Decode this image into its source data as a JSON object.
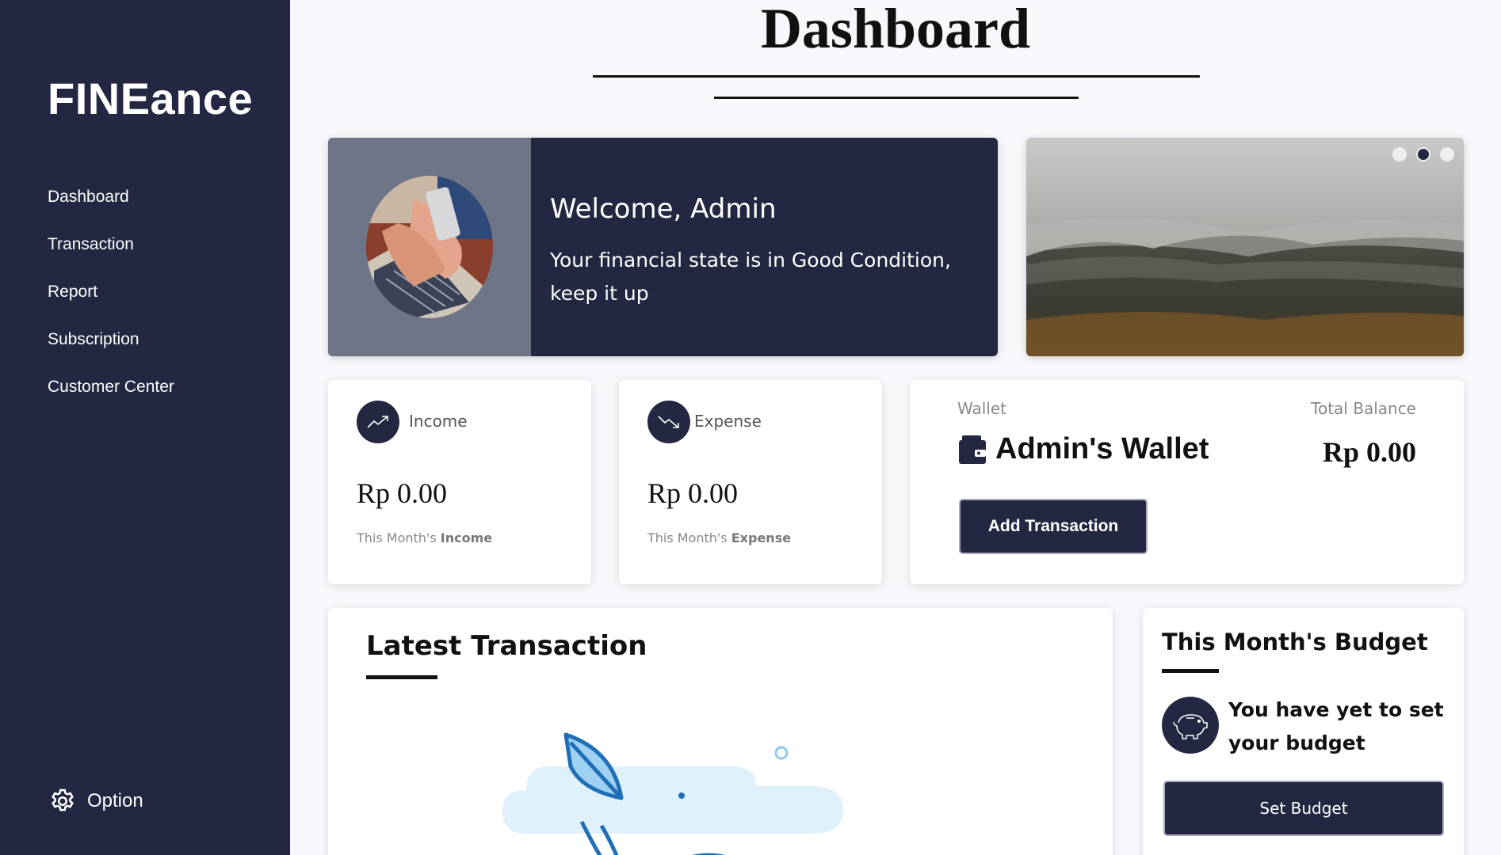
{
  "sidebar": {
    "brand": "FINEance",
    "items": [
      {
        "label": "Dashboard"
      },
      {
        "label": "Transaction"
      },
      {
        "label": "Report"
      },
      {
        "label": "Subscription"
      },
      {
        "label": "Customer Center"
      }
    ],
    "option_label": "Option"
  },
  "header": {
    "title": "Dashboard"
  },
  "welcome": {
    "title": "Welcome, Admin",
    "message": "Your financial state is in Good Condition, keep it up"
  },
  "carousel": {
    "slide_count": 3,
    "active_index": 1
  },
  "income": {
    "label": "Income",
    "value": "Rp 0.00",
    "caption_prefix": "This Month's ",
    "caption_strong": "Income",
    "icon": "trend-up-icon"
  },
  "expense": {
    "label": "Expense",
    "value": "Rp 0.00",
    "caption_prefix": "This Month's ",
    "caption_strong": "Expense",
    "icon": "trend-down-icon"
  },
  "wallet": {
    "label": "Wallet",
    "name": "Admin's Wallet",
    "balance_label": "Total Balance",
    "balance": "Rp 0.00",
    "add_button": "Add Transaction",
    "icon": "wallet-icon"
  },
  "latest": {
    "title": "Latest Transaction"
  },
  "budget": {
    "title": "This Month's Budget",
    "message": "You have yet to set your budget",
    "button": "Set Budget",
    "icon": "piggy-bank-icon"
  },
  "colors": {
    "sidebar": "#232741",
    "accent": "#232741",
    "background": "#f7f8fb",
    "illustration_blue": "#1f6fb8",
    "illustration_cloud": "#dff1fc"
  }
}
